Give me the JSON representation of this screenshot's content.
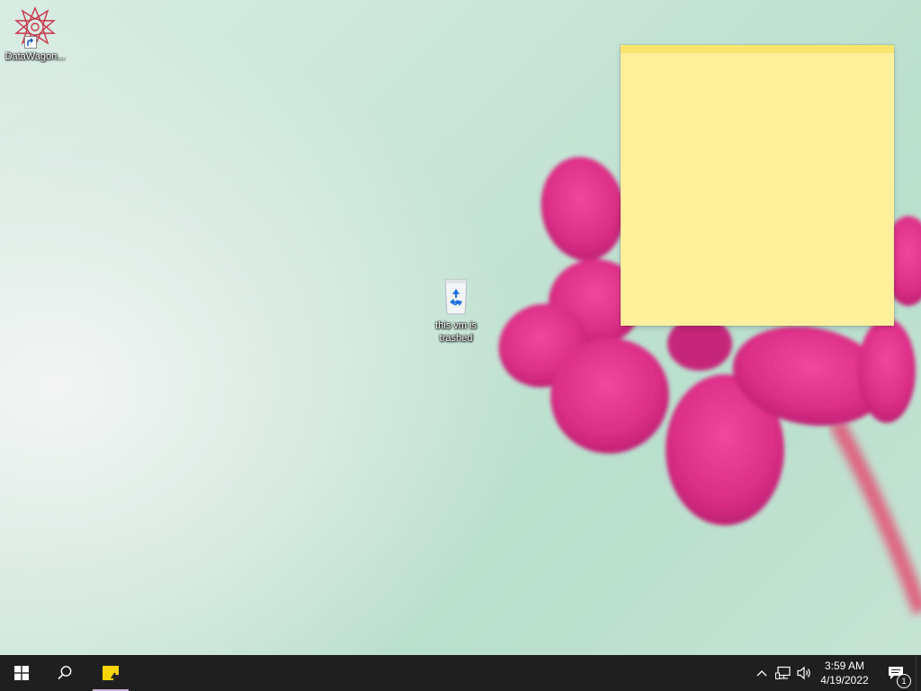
{
  "desktop": {
    "icons": [
      {
        "label": "DataWagon...",
        "icon": "datawagon-logo-shortcut-icon"
      },
      {
        "label": "this vm is trashed",
        "icon": "recycle-bin-icon"
      }
    ],
    "sticky_note": {
      "content": "",
      "color": "#fef09b",
      "header_color": "#f9e46e"
    }
  },
  "taskbar": {
    "start_icon": "windows-logo-icon",
    "search_icon": "search-icon",
    "pinned_apps": [
      {
        "name": "Sticky Notes",
        "icon": "sticky-notes-icon",
        "active": true
      }
    ],
    "tray": {
      "chevron_icon": "chevron-up-icon",
      "network_icon": "network-icon",
      "volume_icon": "volume-icon"
    },
    "clock": {
      "time": "3:59 AM",
      "date": "4/19/2022"
    },
    "notifications": {
      "icon": "action-center-icon",
      "count": "1"
    }
  },
  "colors": {
    "taskbar_bg": "#1f1f1f",
    "flower": "#e2378c",
    "desktop_bg": "#c6e5d6"
  }
}
